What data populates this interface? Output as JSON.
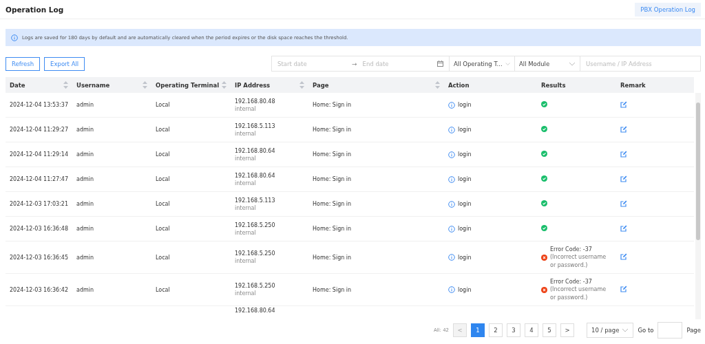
{
  "header": {
    "title": "Operation Log",
    "link_button": "PBX Operation Log"
  },
  "notice": "Logs are saved for 180 days by default and are automatically cleared when the period expires or the disk space reaches the threshold.",
  "toolbar": {
    "buttons": [
      "Refresh",
      "Export All"
    ],
    "start_date": {
      "placeholder": "Start date"
    },
    "date_separator": "→",
    "end_date": {
      "placeholder": "End date"
    },
    "terminal_select": "All Operating T...",
    "module_select": "All Module",
    "search": {
      "placeholder": "Username / IP Address"
    }
  },
  "table": {
    "columns": [
      {
        "label": "Date",
        "sortable": true
      },
      {
        "label": "Username",
        "sortable": true
      },
      {
        "label": "Operating Terminal",
        "sortable": true
      },
      {
        "label": "IP Address",
        "sortable": true
      },
      {
        "label": "Page",
        "sortable": true
      },
      {
        "label": "Action",
        "sortable": false
      },
      {
        "label": "Results",
        "sortable": false
      },
      {
        "label": "Remark",
        "sortable": false
      }
    ],
    "rows": [
      {
        "date": "2024-12-04 13:53:37",
        "username": "admin",
        "terminal": "Local",
        "ip": "192.168.80.48",
        "ip_type": "internal",
        "page": "Home:  Sign in",
        "action": "login",
        "result": {
          "kind": "success"
        }
      },
      {
        "date": "2024-12-04 11:29:27",
        "username": "admin",
        "terminal": "Local",
        "ip": "192.168.5.113",
        "ip_type": "internal",
        "page": "Home:  Sign in",
        "action": "login",
        "result": {
          "kind": "success"
        }
      },
      {
        "date": "2024-12-04 11:29:14",
        "username": "admin",
        "terminal": "Local",
        "ip": "192.168.80.64",
        "ip_type": "internal",
        "page": "Home:  Sign in",
        "action": "login",
        "result": {
          "kind": "success"
        }
      },
      {
        "date": "2024-12-04 11:27:47",
        "username": "admin",
        "terminal": "Local",
        "ip": "192.168.80.64",
        "ip_type": "internal",
        "page": "Home:  Sign in",
        "action": "login",
        "result": {
          "kind": "success"
        }
      },
      {
        "date": "2024-12-03 17:03:21",
        "username": "admin",
        "terminal": "Local",
        "ip": "192.168.5.113",
        "ip_type": "internal",
        "page": "Home:  Sign in",
        "action": "login",
        "result": {
          "kind": "success"
        }
      },
      {
        "date": "2024-12-03 16:36:48",
        "username": "admin",
        "terminal": "Local",
        "ip": "192.168.5.250",
        "ip_type": "internal",
        "page": "Home:  Sign in",
        "action": "login",
        "result": {
          "kind": "success"
        }
      },
      {
        "date": "2024-12-03 16:36:45",
        "username": "admin",
        "terminal": "Local",
        "ip": "192.168.5.250",
        "ip_type": "internal",
        "page": "Home:  Sign in",
        "action": "login",
        "result": {
          "kind": "error",
          "code": "Error Code: -37",
          "message": "(Incorrect username or password.)"
        }
      },
      {
        "date": "2024-12-03 16:36:42",
        "username": "admin",
        "terminal": "Local",
        "ip": "192.168.5.250",
        "ip_type": "internal",
        "page": "Home:  Sign in",
        "action": "login",
        "result": {
          "kind": "error",
          "code": "Error Code: -37",
          "message": "(Incorrect username or password.)"
        }
      }
    ],
    "partial_row": {
      "ip": "192.168.80.64"
    }
  },
  "pagination": {
    "total": "All: 42",
    "prev": "<",
    "pages": [
      {
        "label": "1",
        "selected": true
      },
      {
        "label": "2",
        "selected": false
      },
      {
        "label": "3",
        "selected": false
      },
      {
        "label": "4",
        "selected": false
      },
      {
        "label": "5",
        "selected": false
      }
    ],
    "next": ">",
    "page_size": "10 / page",
    "goto_label": "Go to",
    "goto_suffix": "Page"
  }
}
